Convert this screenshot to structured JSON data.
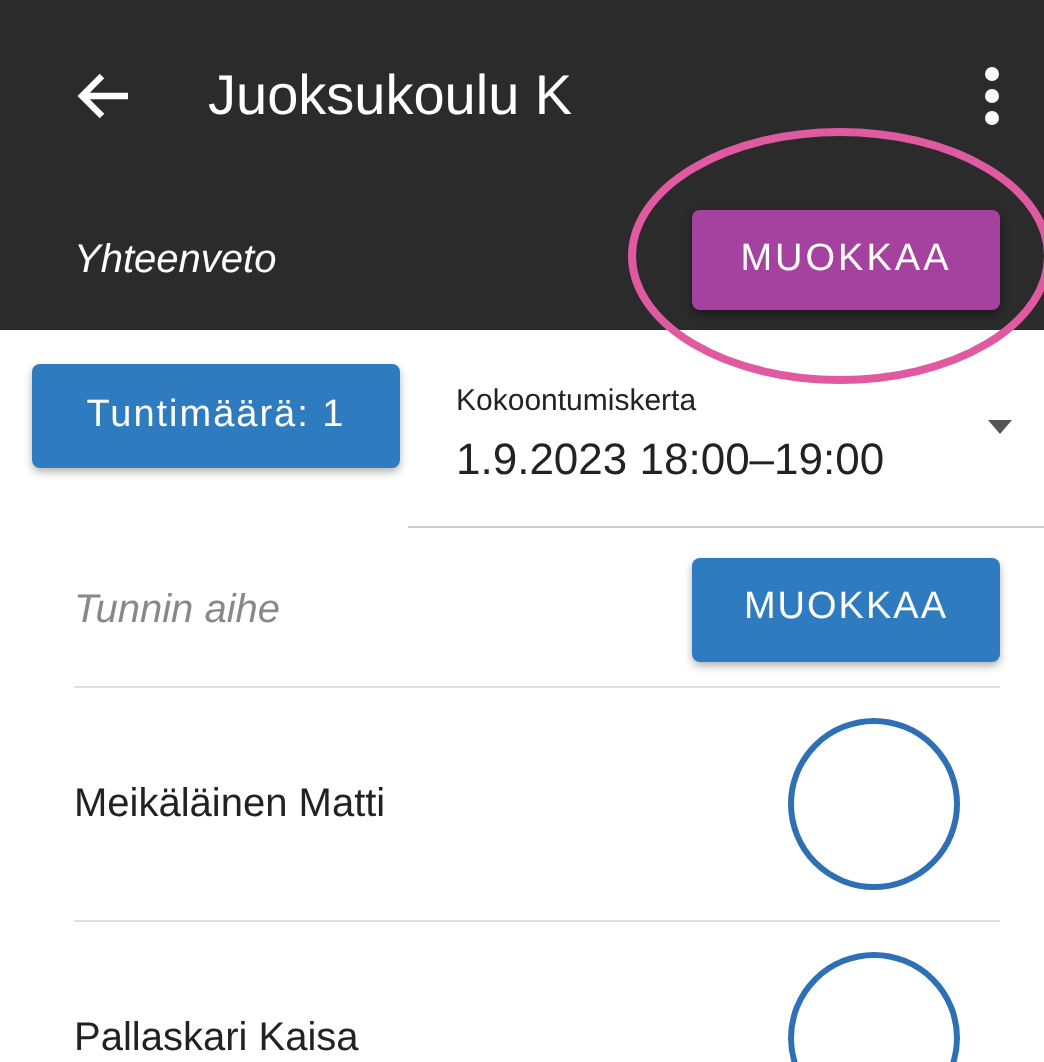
{
  "app_bar": {
    "title": "Juoksukoulu K"
  },
  "summary": {
    "label": "Yhteenveto",
    "button": "MUOKKAA"
  },
  "hours_button": "Tuntimäärä: 1",
  "session_select": {
    "label": "Kokoontumiskerta",
    "value": "1.9.2023 18:00–19:00"
  },
  "topic": {
    "placeholder": "Tunnin aihe",
    "button": "MUOKKAA"
  },
  "participants": [
    {
      "name": "Meikäläinen Matti",
      "selected": false
    },
    {
      "name": "Pallaskari Kaisa",
      "selected": false
    }
  ]
}
